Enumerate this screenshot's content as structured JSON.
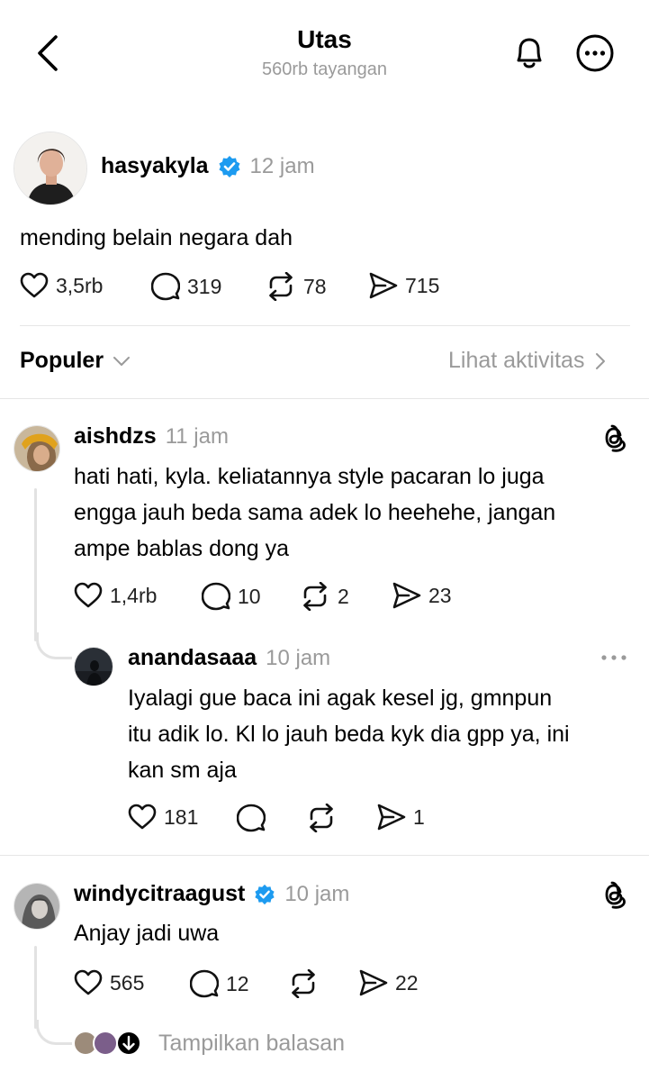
{
  "header": {
    "title": "Utas",
    "subtitle": "560rb tayangan"
  },
  "post": {
    "username": "hasyakyla",
    "verified": true,
    "time": "12 jam",
    "text": "mending belain negara dah",
    "likes": "3,5rb",
    "comments": "319",
    "reposts": "78",
    "shares": "715"
  },
  "filter": {
    "sort_label": "Populer",
    "activity_label": "Lihat aktivitas"
  },
  "replies": [
    {
      "username": "aishdzs",
      "time": "11 jam",
      "lines": [
        "hati hati, kyla. keliatannya style pacaran lo juga",
        "engga jauh beda sama adek lo heehehe, jangan",
        "ampe bablas dong ya"
      ],
      "likes": "1,4rb",
      "comments": "10",
      "reposts": "2",
      "shares": "23"
    },
    {
      "username": "anandasaaa",
      "time": "10 jam",
      "lines": [
        "Iyalagi gue baca ini agak kesel jg, gmnpun",
        "itu adik lo. Kl lo jauh beda kyk dia gpp ya, ini",
        "kan sm aja"
      ],
      "likes": "181",
      "shares": "1"
    },
    {
      "username": "windycitraagust",
      "verified": true,
      "time": "10 jam",
      "lines": [
        "Anjay jadi uwa"
      ],
      "likes": "565",
      "comments": "12",
      "shares": "22"
    }
  ],
  "show_replies_label": "Tampilkan balasan",
  "colors": {
    "verified_blue": "#1d9bf0",
    "muted_gray": "#9a9a9a",
    "divider": "#e6e6e6"
  }
}
